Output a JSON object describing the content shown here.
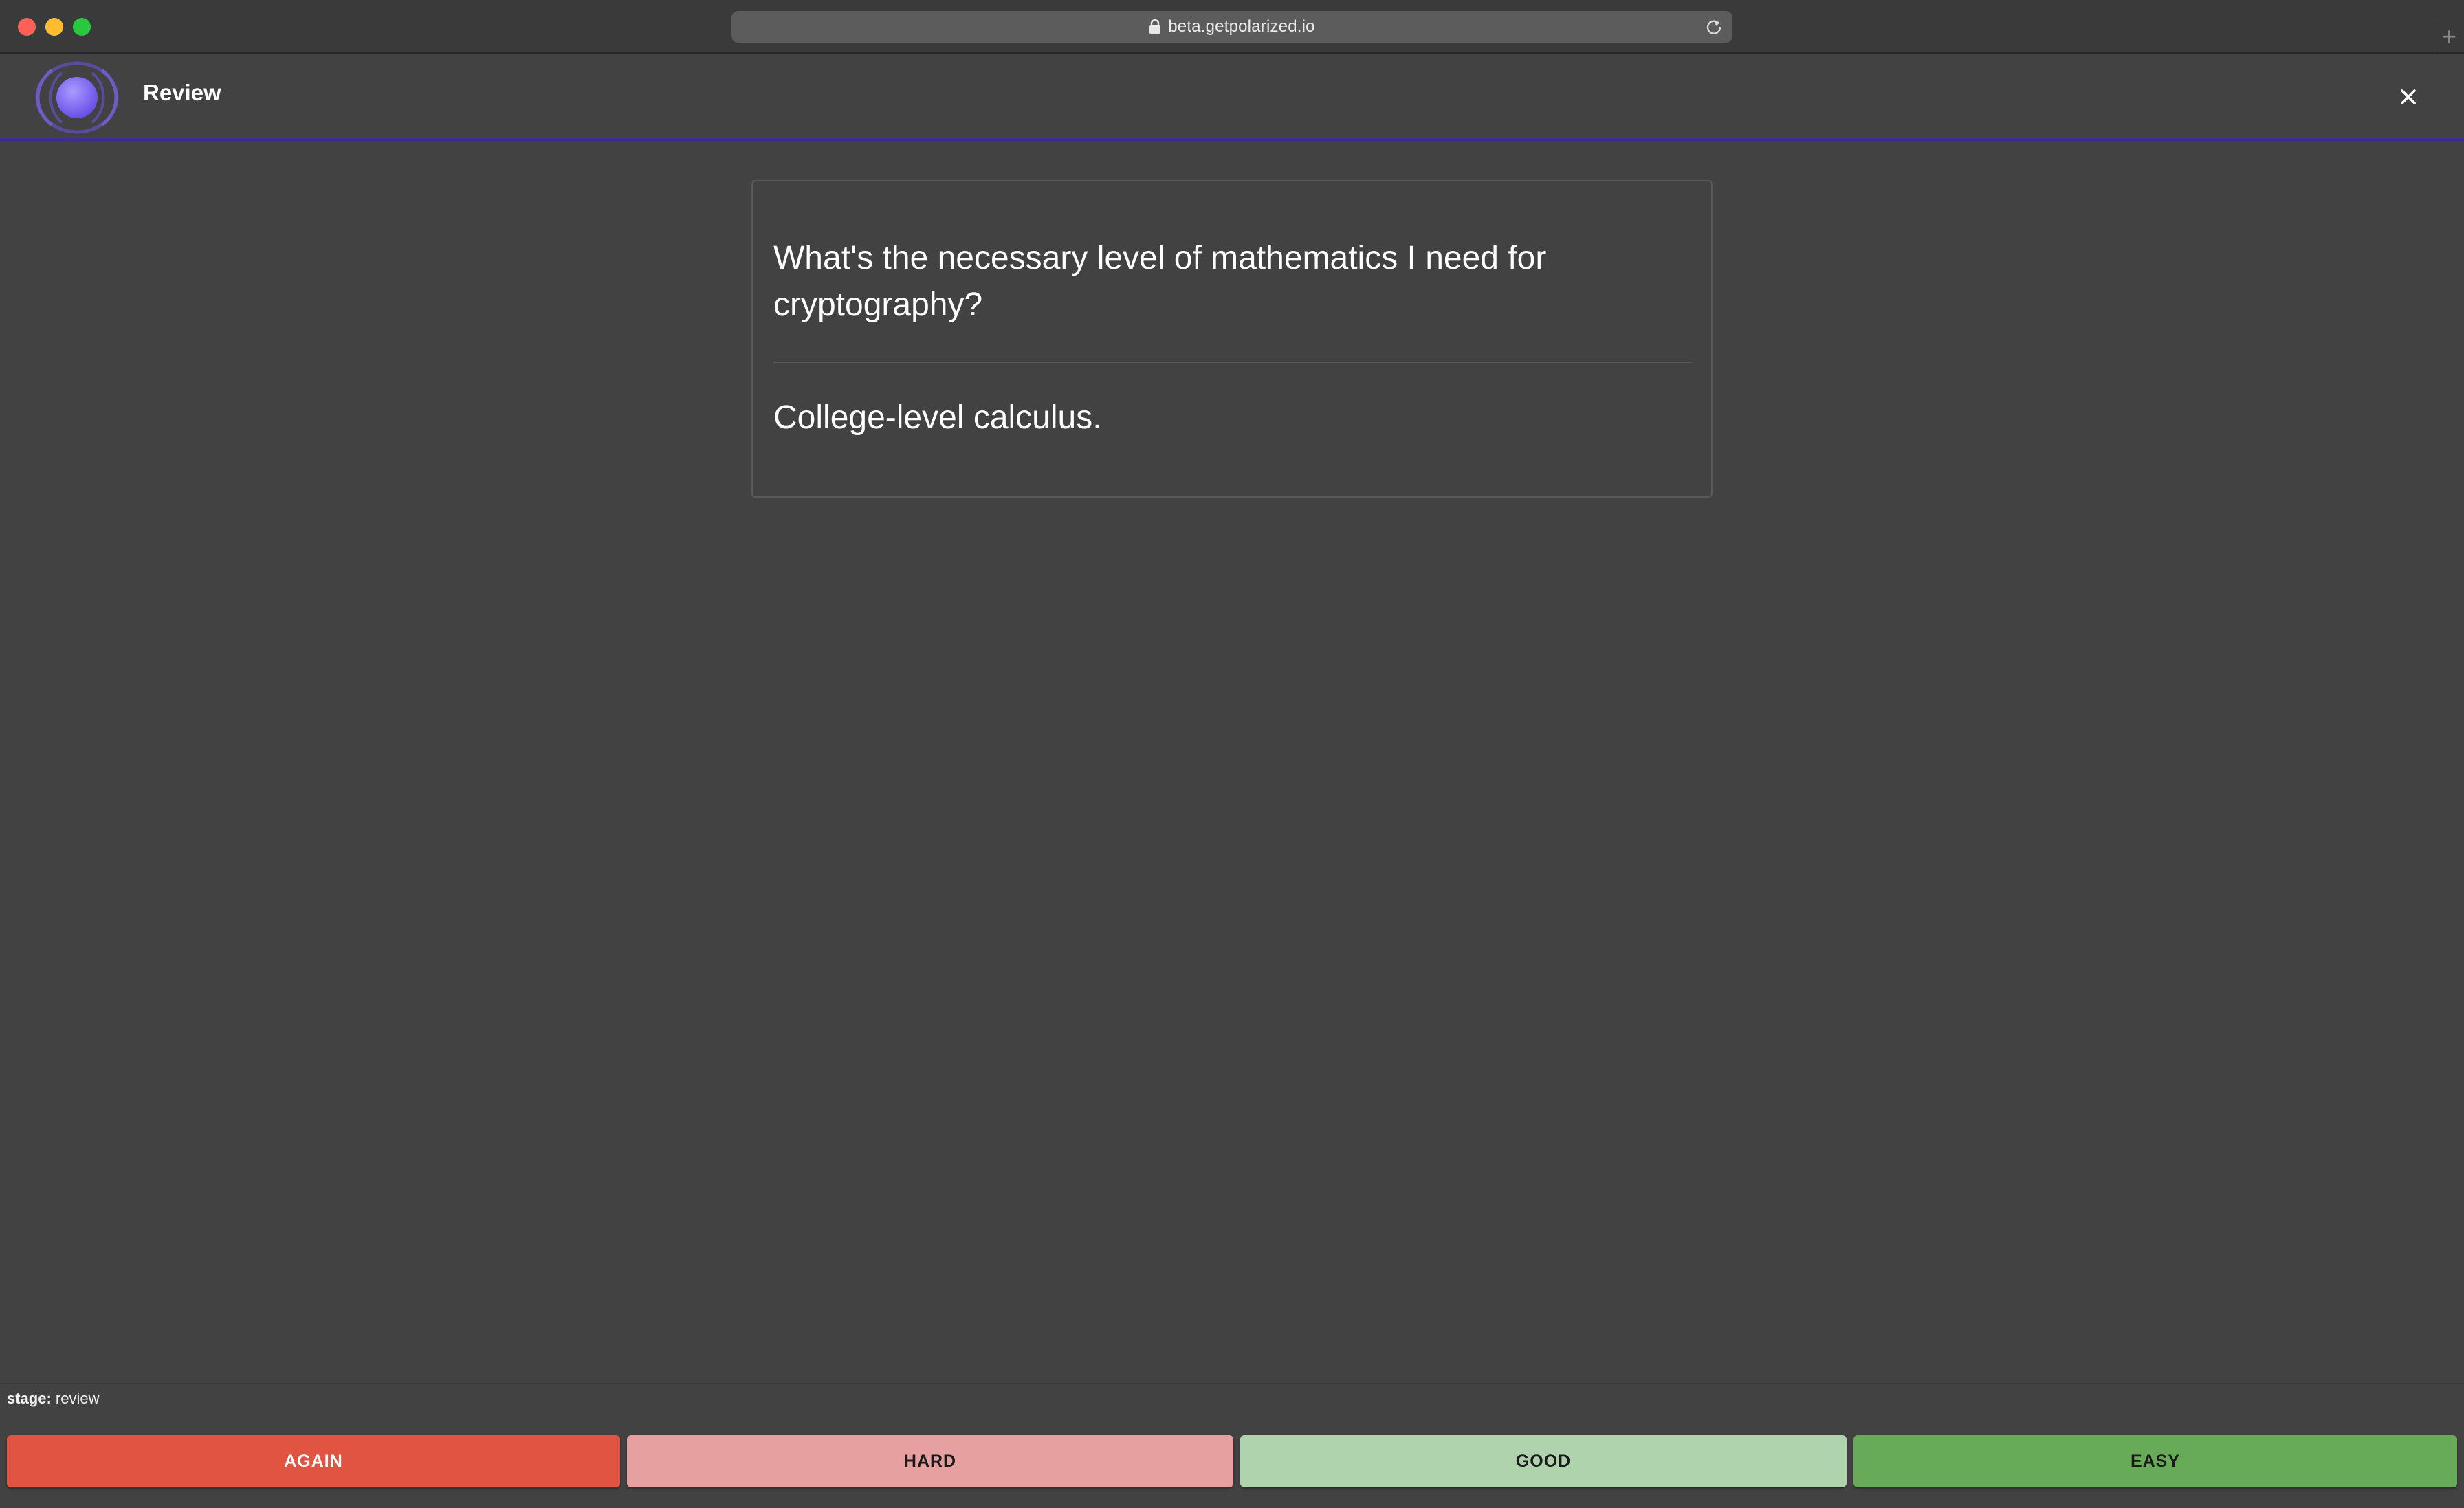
{
  "browser": {
    "url": "beta.getpolarized.io",
    "new_tab_label": "+"
  },
  "header": {
    "title": "Review",
    "logo_icon": "polar-logo-icon",
    "close_icon": "close-icon"
  },
  "card": {
    "question": "What's the necessary level of mathematics I need for cryptography?",
    "answer": "College-level calculus."
  },
  "footer": {
    "stage_label": "stage:",
    "stage_value": "review"
  },
  "ratings": {
    "again": "AGAIN",
    "hard": "HARD",
    "good": "GOOD",
    "easy": "EASY"
  },
  "colors": {
    "background": "#424242",
    "header_accent": "#3d2f8a",
    "again": "#e05441",
    "hard": "#e6a09f",
    "good": "#afd4ad",
    "easy": "#67aa57"
  }
}
